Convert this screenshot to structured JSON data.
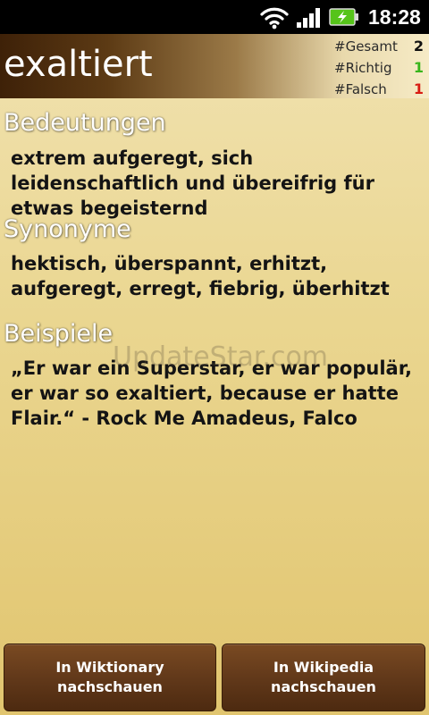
{
  "status_bar": {
    "time": "18:28",
    "icons": [
      "wifi-icon",
      "signal-icon",
      "battery-charging-icon"
    ],
    "battery_color": "#56c41a"
  },
  "header": {
    "word": "exaltiert",
    "stats": [
      {
        "label": "#Gesamt",
        "value": "2",
        "color": "#111111"
      },
      {
        "label": "#Richtig",
        "value": "1",
        "color": "#38b51b"
      },
      {
        "label": "#Falsch",
        "value": "1",
        "color": "#d81c12"
      }
    ]
  },
  "sections": {
    "meanings": {
      "heading": "Bedeutungen",
      "text": "extrem aufgeregt, sich leidenschaftlich und übereifrig für etwas begeisternd"
    },
    "synonyms": {
      "heading": "Synonyme",
      "text": "hektisch, überspannt, erhitzt, aufgeregt, erregt, fiebrig, überhitzt"
    },
    "examples": {
      "heading": "Beispiele",
      "text": "„Er war ein Superstar, er war populär, er war so exaltiert, because er hatte Flair.“ - Rock Me Amadeus, Falco"
    }
  },
  "watermark": "UpdateStar.com",
  "buttons": {
    "wiktionary": "In Wiktionary nachschauen",
    "wikipedia": "In Wikipedia nachschauen"
  }
}
